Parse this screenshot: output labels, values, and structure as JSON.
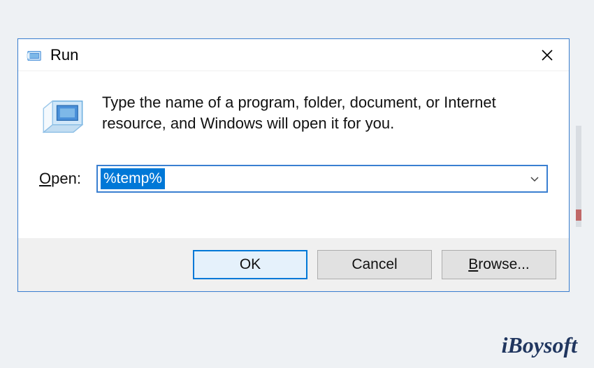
{
  "dialog": {
    "title": "Run",
    "description": "Type the name of a program, folder, document, or Internet resource, and Windows will open it for you.",
    "open_label_prefix": "O",
    "open_label_rest": "pen:",
    "input_value": "%temp%",
    "buttons": {
      "ok": "OK",
      "cancel": "Cancel",
      "browse_prefix": "B",
      "browse_rest": "rowse..."
    }
  },
  "watermark": "iBoysoft"
}
